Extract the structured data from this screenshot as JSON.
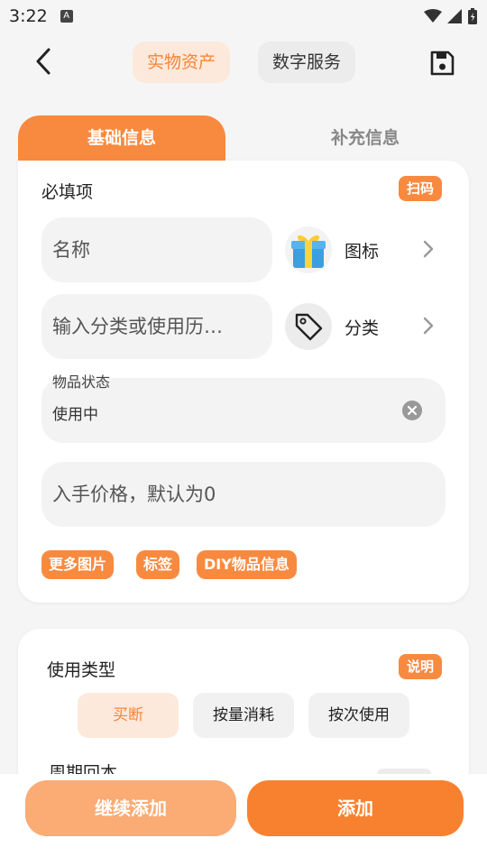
{
  "status_bar": {
    "time": "3:22",
    "notification_glyph": "A"
  },
  "header": {
    "tabs": [
      {
        "label": "实物资产",
        "active": true
      },
      {
        "label": "数字服务",
        "active": false
      }
    ],
    "icons": {
      "back": "chevron-left-icon",
      "save": "save-icon"
    }
  },
  "section_tabs": [
    {
      "label": "基础信息",
      "active": true
    },
    {
      "label": "补充信息",
      "active": false
    }
  ],
  "required_card": {
    "title": "必填项",
    "scan_label": "扫码",
    "name_placeholder": "名称",
    "icon_label": "图标",
    "category_placeholder": "输入分类或使用历…",
    "category_label": "分类",
    "status_label": "物品状态",
    "status_value": "使用中",
    "price_placeholder": "入手价格，默认为0",
    "chips": [
      "更多图片",
      "标签",
      "DIY物品信息"
    ]
  },
  "usage_card": {
    "title": "使用类型",
    "help_label": "说明",
    "types": [
      {
        "label": "买断",
        "active": true
      },
      {
        "label": "按量消耗",
        "active": false
      },
      {
        "label": "按次使用",
        "active": false
      }
    ],
    "cycle_label": "周期回本"
  },
  "footer": {
    "continue_label": "继续添加",
    "add_label": "添加"
  },
  "colors": {
    "accent": "#f88a40",
    "accent_light": "#fde9db",
    "accent_soft": "#fbab74"
  }
}
